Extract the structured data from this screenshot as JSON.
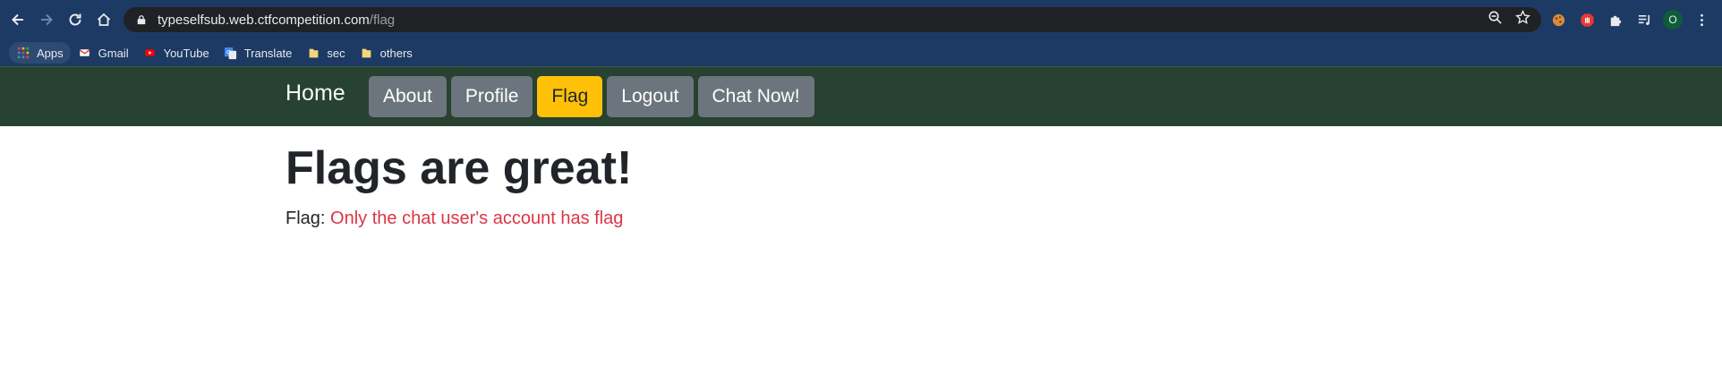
{
  "browser": {
    "url_host": "typeselfsub.web.ctfcompetition.com",
    "url_path": "/flag",
    "profile_initial": "O",
    "bookmarks": [
      {
        "label": "Apps",
        "icon": "apps-grid-icon"
      },
      {
        "label": "Gmail",
        "icon": "gmail-icon"
      },
      {
        "label": "YouTube",
        "icon": "youtube-icon"
      },
      {
        "label": "Translate",
        "icon": "translate-icon"
      },
      {
        "label": "sec",
        "icon": "folder-icon"
      },
      {
        "label": "others",
        "icon": "folder-icon"
      }
    ]
  },
  "navbar": {
    "brand": "Home",
    "items": [
      {
        "label": "About",
        "active": false
      },
      {
        "label": "Profile",
        "active": false
      },
      {
        "label": "Flag",
        "active": true
      },
      {
        "label": "Logout",
        "active": false
      },
      {
        "label": "Chat Now!",
        "active": false
      }
    ]
  },
  "main": {
    "heading": "Flags are great!",
    "flag_label": "Flag:",
    "flag_value": "Only the chat user's account has flag"
  },
  "colors": {
    "chrome_bg": "#1c3a63",
    "navbar_bg": "#274230",
    "nav_button": "#6c757d",
    "nav_button_active": "#ffc107",
    "flag_text": "#dc3545"
  }
}
